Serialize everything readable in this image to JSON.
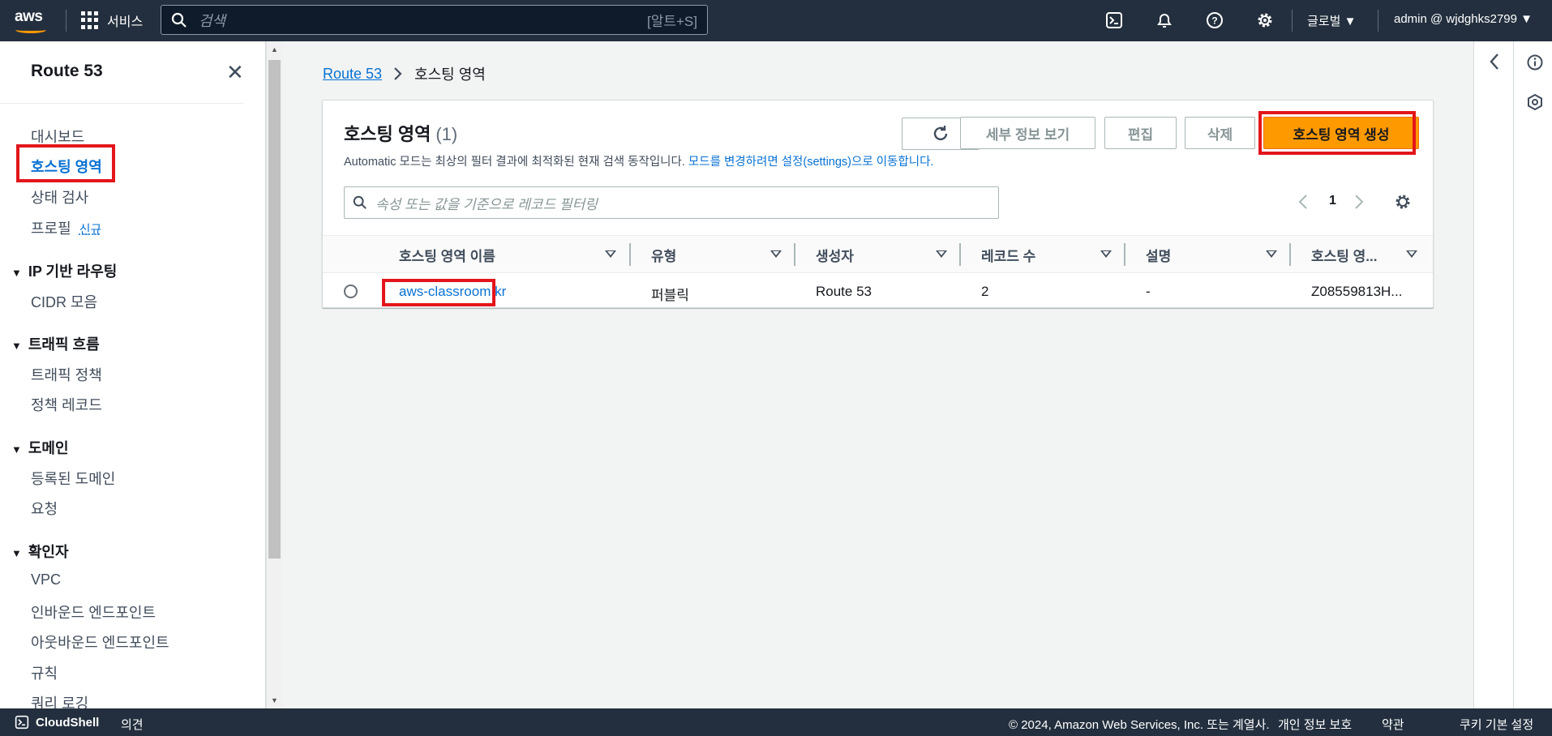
{
  "topnav": {
    "logo_text": "aws",
    "services_label": "서비스",
    "search_placeholder": "검색",
    "search_shortcut": "[알트+S]",
    "icons": [
      "cloudshell-icon",
      "notifications-icon",
      "help-icon",
      "settings-icon"
    ],
    "region_label": "글로벌 ▼",
    "account_label": "admin @ wjdghks2799 ▼"
  },
  "sidebar": {
    "title": "Route 53",
    "items": [
      {
        "label": "대시보드"
      },
      {
        "label": "호스팅 영역"
      },
      {
        "label": "상태 검사"
      },
      {
        "label": "프로필",
        "badge": "신규"
      }
    ],
    "sections": [
      {
        "title": "IP 기반 라우팅",
        "items": [
          "CIDR 모음"
        ]
      },
      {
        "title": "트래픽 흐름",
        "items": [
          "트래픽 정책",
          "정책 레코드"
        ]
      },
      {
        "title": "도메인",
        "items": [
          "등록된 도메인",
          "요청"
        ]
      },
      {
        "title": "확인자",
        "items": [
          "VPC",
          "인바운드 엔드포인트",
          "아웃바운드 엔드포인트",
          "규칙",
          "쿼리 로깅"
        ]
      }
    ]
  },
  "breadcrumb": {
    "root": "Route 53",
    "current": "호스팅 영역"
  },
  "panel": {
    "title": "호스팅 영역",
    "count": "(1)",
    "description": "Automatic 모드는 최상의 필터 결과에 최적화된 현재 검색 동작입니다.",
    "description_link": "모드를 변경하려면 설정(settings)으로 이동합니다.",
    "buttons": {
      "details": "세부 정보 보기",
      "edit": "편집",
      "delete": "삭제",
      "create": "호스팅 영역 생성"
    },
    "filter_placeholder": "속성 또는 값을 기준으로 레코드 필터링",
    "page_number": "1"
  },
  "table": {
    "columns": [
      "호스팅 영역 이름",
      "유형",
      "생성자",
      "레코드 수",
      "설명",
      "호스팅 영..."
    ],
    "rows": [
      {
        "name": "aws-classroom.kr",
        "type": "퍼블릭",
        "created_by": "Route 53",
        "record_count": "2",
        "description": "-",
        "zone_id": "Z08559813H..."
      }
    ]
  },
  "footer": {
    "cloudshell": "CloudShell",
    "feedback": "의견",
    "copyright": "© 2024, Amazon Web Services, Inc. 또는 계열사.",
    "privacy": "개인 정보 보호",
    "terms": "약관",
    "cookies": "쿠키 기본 설정"
  },
  "colors": {
    "nav_bg": "#232f3e",
    "primary": "#ff9900",
    "link": "#0972d3",
    "highlight": "#e3161b"
  }
}
